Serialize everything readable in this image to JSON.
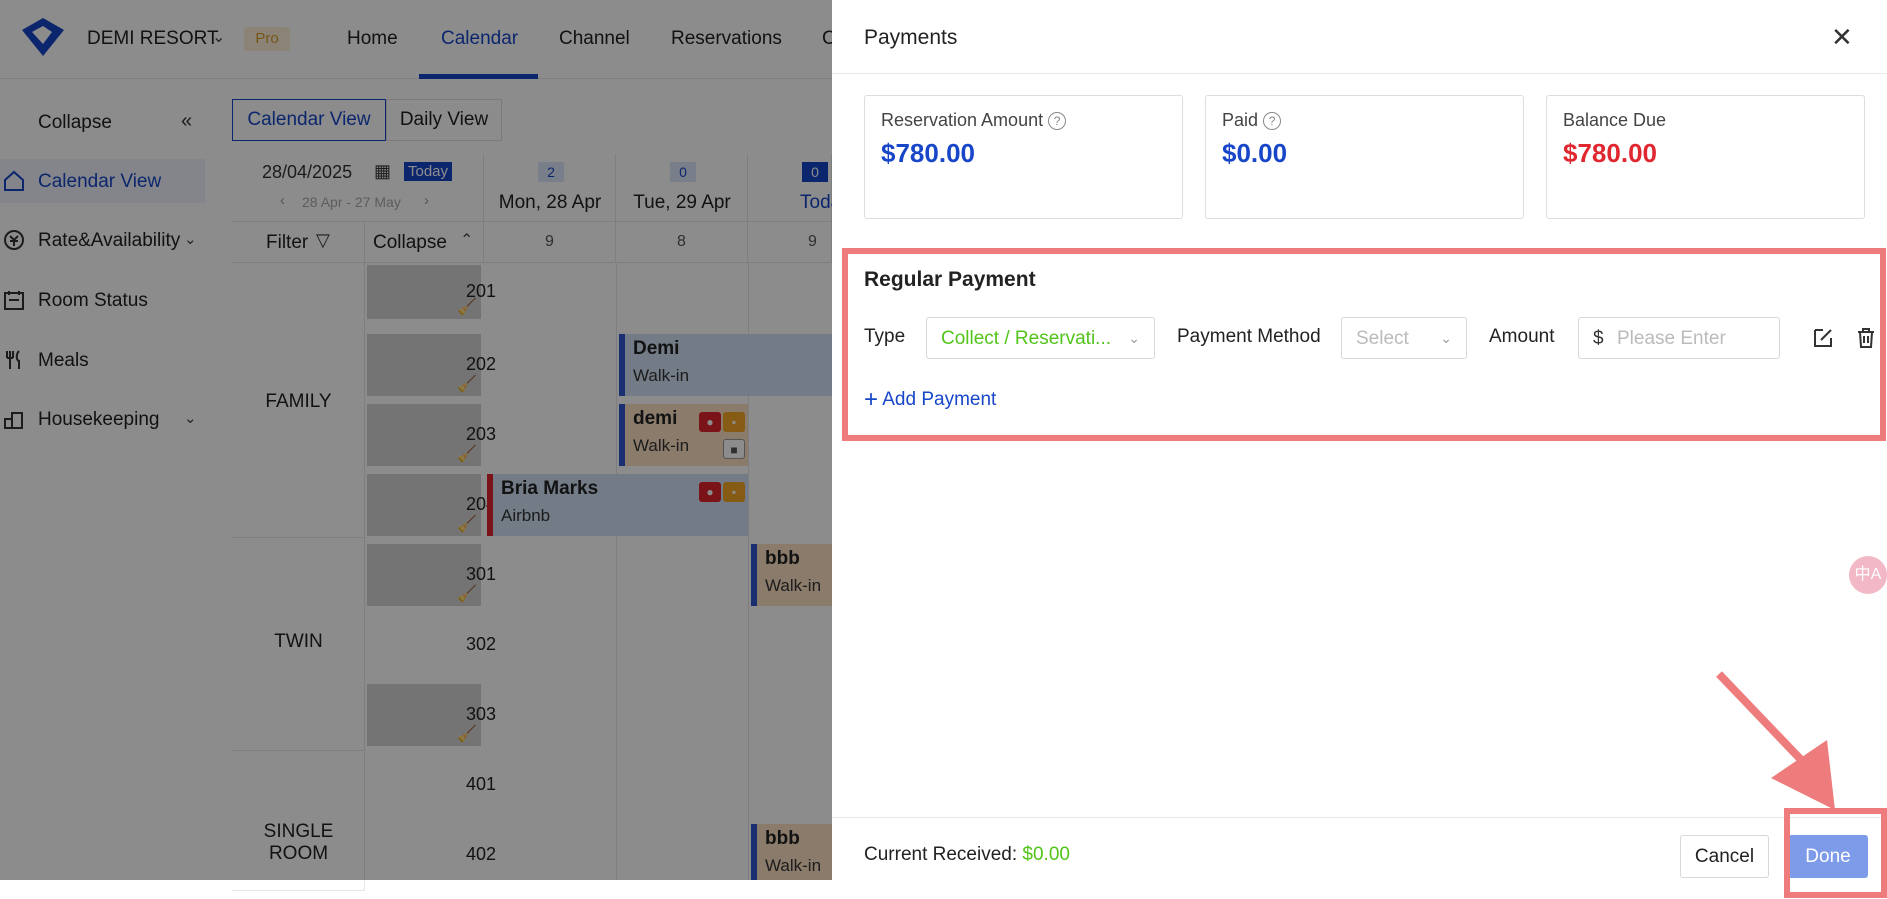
{
  "topnav": {
    "brand": "DEMI RESORT",
    "badge": "Pro",
    "items": [
      "Home",
      "Calendar",
      "Channel",
      "Reservations",
      "C"
    ]
  },
  "sidebar": {
    "collapse_label": "Collapse",
    "items": [
      {
        "label": "Calendar View",
        "icon": "home-icon"
      },
      {
        "label": "Rate&Availability",
        "icon": "price-icon"
      },
      {
        "label": "Room Status",
        "icon": "calendar-icon"
      },
      {
        "label": "Meals",
        "icon": "fork-knife-icon"
      },
      {
        "label": "Housekeeping",
        "icon": "housekeeping-icon"
      }
    ]
  },
  "calendar": {
    "view_tabs": [
      "Calendar View",
      "Daily View"
    ],
    "date": "28/04/2025",
    "today_label": "Today",
    "range": "28 Apr - 27 May",
    "filter_label": "Filter",
    "collapse_label": "Collapse",
    "days": [
      {
        "badge": "2",
        "label": "Mon, 28 Apr",
        "count": "9"
      },
      {
        "badge": "0",
        "label": "Tue, 29 Apr",
        "count": "8"
      },
      {
        "badge": "0",
        "label": "Toda",
        "count": "9"
      }
    ],
    "room_types": [
      "FAMILY",
      "TWIN",
      "SINGLE ROOM"
    ],
    "rooms": [
      "201",
      "202",
      "203",
      "204",
      "301",
      "302",
      "303",
      "401",
      "402"
    ],
    "bookings": [
      {
        "name": "Demi",
        "source": "Walk-in"
      },
      {
        "name": "demi",
        "source": "Walk-in"
      },
      {
        "name": "Bria Marks",
        "source": "Airbnb"
      },
      {
        "name": "bbb",
        "source": "Walk-in"
      },
      {
        "name": "bbb",
        "source": "Walk-in"
      }
    ]
  },
  "payments": {
    "title": "Payments",
    "cards": [
      {
        "label": "Reservation Amount",
        "value": "$780.00",
        "color": "#1746c9"
      },
      {
        "label": "Paid",
        "value": "$0.00",
        "color": "#1746c9"
      },
      {
        "label": "Balance Due",
        "value": "$780.00",
        "color": "#e0262e"
      }
    ],
    "regular_title": "Regular Payment",
    "type_label": "Type",
    "type_value": "Collect / Reservati...",
    "method_label": "Payment Method",
    "method_placeholder": "Select",
    "amount_label": "Amount",
    "currency_symbol": "$",
    "amount_placeholder": "Please Enter",
    "add_payment": "Add Payment",
    "current_received_label": "Current Received:",
    "current_received_value": "$0.00",
    "cancel": "Cancel",
    "done": "Done",
    "translate_glyph": "中A"
  }
}
